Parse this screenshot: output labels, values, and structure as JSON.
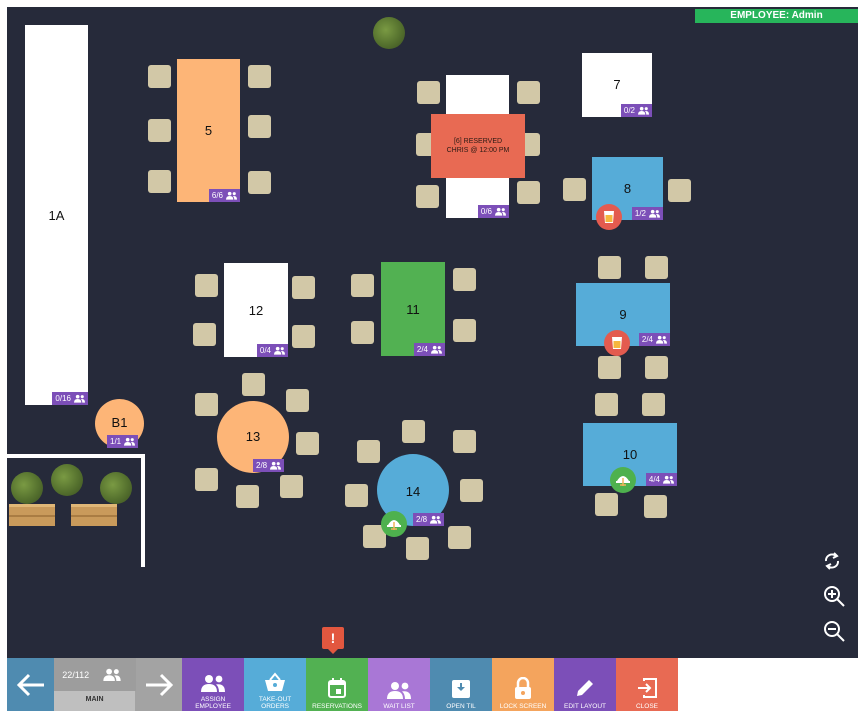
{
  "employee": "EMPLOYEE: Admin",
  "tables": {
    "t1a": {
      "num": "1A",
      "count": "0/16"
    },
    "t5": {
      "num": "5",
      "count": "6/6"
    },
    "t7": {
      "num": "7",
      "count": "0/2"
    },
    "t8": {
      "num": "8",
      "count": "1/2"
    },
    "t9": {
      "num": "9",
      "count": "2/4"
    },
    "t10": {
      "num": "10",
      "count": "4/4"
    },
    "t11": {
      "num": "11",
      "count": "2/4"
    },
    "t12": {
      "num": "12",
      "count": "0/4"
    },
    "t13": {
      "num": "13",
      "count": "2/8"
    },
    "t14": {
      "num": "14",
      "count": "2/8"
    },
    "tb1": {
      "num": "B1",
      "count": "1/1"
    },
    "t6": {
      "count": "0/6",
      "reserved_line1": "[6] RESERVED",
      "reserved_line2": "CHRIS @ 12:00 PM"
    }
  },
  "colors": {
    "floor": "#262a3a",
    "orange": "#fdb577",
    "blue": "#56acd8",
    "green": "#52b152",
    "white": "#ffffff",
    "purple_badge": "#7c4fb8",
    "reserved": "#e86a53"
  },
  "toolbar": {
    "seat_count": "22/112",
    "section": "MAIN",
    "buttons": [
      {
        "label": "ASSIGN\nEMPLOYEE",
        "color": "#7c4fb8",
        "icon": "people-icon"
      },
      {
        "label": "TAKE-OUT\nORDERS",
        "color": "#56acd8",
        "icon": "basket-icon"
      },
      {
        "label": "RESERVATIONS",
        "color": "#52b152",
        "icon": "calendar-icon"
      },
      {
        "label": "WAIT LIST",
        "color": "#a977d6",
        "icon": "people-icon"
      },
      {
        "label": "OPEN TIL",
        "color": "#4f8bb0",
        "icon": "drawer-icon"
      },
      {
        "label": "LOCK SCREEN",
        "color": "#f4a45d",
        "icon": "lock-icon"
      },
      {
        "label": "EDIT LAYOUT",
        "color": "#7c4fb8",
        "icon": "pencil-icon"
      },
      {
        "label": "CLOSE",
        "color": "#e86a53",
        "icon": "exit-icon"
      }
    ]
  },
  "alert_mark": "!"
}
